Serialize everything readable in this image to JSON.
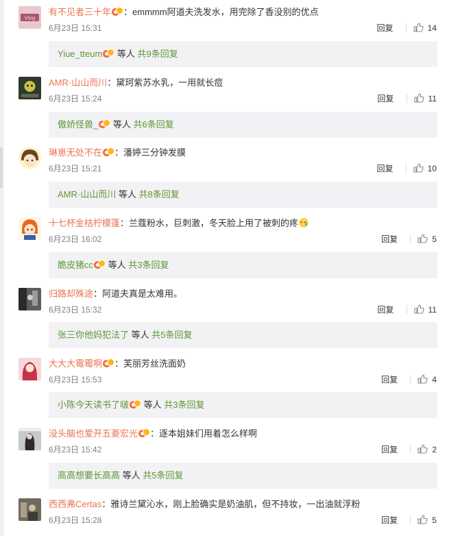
{
  "comments": [
    {
      "user": "有不见者三十年",
      "vip": true,
      "sep": "：",
      "text": "emmmm阿道夫洗发水，用完除了香没别的优点",
      "emoji": false,
      "time": "6月23日 15:31",
      "reply": "回复",
      "likes": "14",
      "sub_user": "Yiue_tteum",
      "sub_vip": true,
      "sub_etc": "等人",
      "sub_more": "共9条回复"
    },
    {
      "user": "AMR·山山而川",
      "vip": false,
      "sep": "：",
      "text": "黛珂紫苏水乳，一用就长痘",
      "emoji": false,
      "time": "6月23日 15:24",
      "reply": "回复",
      "likes": "11",
      "sub_user": "傲娇怪兽_",
      "sub_vip": true,
      "sub_etc": "等人",
      "sub_more": "共6条回复"
    },
    {
      "user": "琳崽无处不在",
      "vip": true,
      "sep": "：",
      "text": "潘婷三分钟发膜",
      "emoji": false,
      "time": "6月23日 15:21",
      "reply": "回复",
      "likes": "10",
      "sub_user": "AMR·山山而川",
      "sub_vip": false,
      "sub_etc": "等人",
      "sub_more": "共8条回复"
    },
    {
      "user": "十七杯金桔柠檬蓬",
      "vip": false,
      "sep": "：",
      "text": "兰蔻粉水，巨刺激，冬天脸上用了被刺的疼",
      "emoji": true,
      "time": "6月23日 16:02",
      "reply": "回复",
      "likes": "5",
      "sub_user": "脆皮猪cc",
      "sub_vip": true,
      "sub_etc": "等人",
      "sub_more": "共3条回复"
    },
    {
      "user": "归路却殊途",
      "vip": false,
      "sep": "：",
      "text": "阿道夫真是太难用。",
      "emoji": false,
      "time": "6月23日 15:32",
      "reply": "回复",
      "likes": "11",
      "sub_user": "张三你他妈犯法了",
      "sub_vip": false,
      "sub_etc": "等人",
      "sub_more": "共5条回复"
    },
    {
      "user": "大大大霉霉啊",
      "vip": true,
      "sep": "：",
      "text": "芙丽芳丝洗面奶",
      "emoji": false,
      "time": "6月23日 15:53",
      "reply": "回复",
      "likes": "4",
      "sub_user": "小陈今天读书了啵",
      "sub_vip": true,
      "sub_etc": "等人",
      "sub_more": "共3条回复"
    },
    {
      "user": "没头脑也爱开五菱宏光",
      "vip": true,
      "sep": "：",
      "text": "逐本姐妹们用着怎么样啊",
      "emoji": false,
      "time": "6月23日 15:42",
      "reply": "回复",
      "likes": "2",
      "sub_user": "高高想要长高高",
      "sub_vip": false,
      "sub_etc": "等人",
      "sub_more": "共5条回复"
    },
    {
      "user": "西西弗Certas",
      "vip": false,
      "sep": "：",
      "text": "雅诗兰黛沁水，刚上脸确实是奶油肌，但不持妆，一出油就浮粉",
      "emoji": false,
      "time": "6月23日 15:28",
      "reply": "回复",
      "likes": "5"
    }
  ],
  "icons": {
    "like": "thumbs-up-icon",
    "vip": "vip-badge-icon",
    "emoji": "crying-face-emoji-icon"
  },
  "colors": {
    "username": "#eb7350",
    "sub_username": "#5d9632",
    "subbox_bg": "#f2f2f5",
    "time": "#808080"
  }
}
